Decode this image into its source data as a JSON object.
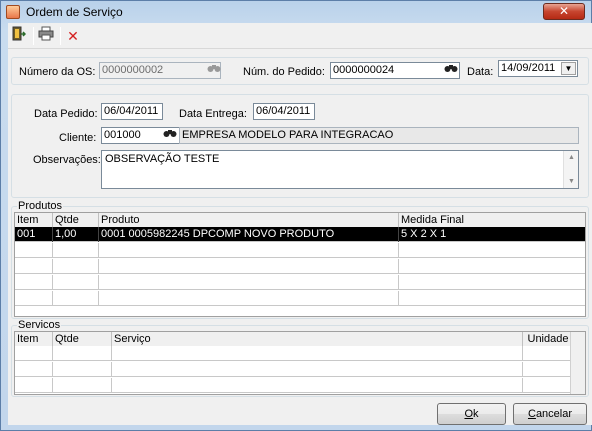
{
  "window": {
    "title": "Ordem de Serviço",
    "close_glyph": "✕",
    "icon": "app-icon"
  },
  "toolbar": {
    "buttons": [
      {
        "name": "exit-door-icon",
        "glyph": "🚪"
      },
      {
        "name": "printer-icon",
        "glyph": "🖶"
      },
      {
        "name": "delete-x-icon",
        "glyph": "✕",
        "color": "#d42020"
      }
    ]
  },
  "header": {
    "os_label": "Número da OS:",
    "os_value": "0000000002",
    "pedido_label": "Núm. do Pedido:",
    "pedido_value": "0000000024",
    "data_label": "Data:",
    "data_value": "14/09/2011",
    "dropdown_glyph": "▼",
    "binoculars_glyph": "👓"
  },
  "pedido": {
    "data_pedido_label": "Data Pedido:",
    "data_pedido_value": "06/04/2011",
    "data_entrega_label": "Data Entrega:",
    "data_entrega_value": "06/04/2011",
    "cliente_label": "Cliente:",
    "cliente_code": "001000",
    "cliente_name": "EMPRESA MODELO PARA INTEGRACAO",
    "obs_label": "Observações:",
    "obs_value": "OBSERVAÇÃO TESTE"
  },
  "produtos": {
    "title": "Produtos",
    "columns": [
      "Item",
      "Qtde",
      "Produto",
      "Medida Final"
    ],
    "rows": [
      [
        "001",
        "1,00",
        "0001 0005982245 DPCOMP NOVO PRODUTO",
        "5 X 2 X 1"
      ]
    ]
  },
  "servicos": {
    "title": "Servicos",
    "columns": [
      "Item",
      "Qtde",
      "Serviço",
      "Unidade"
    ],
    "rows": []
  },
  "buttons": {
    "ok_underline": "O",
    "ok_rest": "k",
    "cancel_underline": "C",
    "cancel_rest": "ancelar"
  },
  "colors": {
    "selected_row": "#000000",
    "titlebar": "#b9d1ea",
    "close_button": "#c7452f"
  }
}
